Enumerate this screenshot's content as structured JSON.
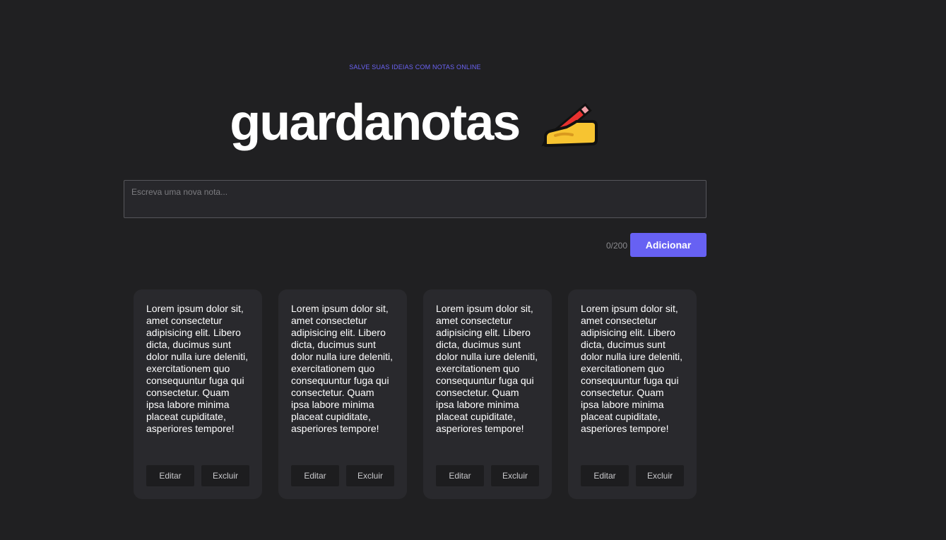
{
  "header": {
    "tagline": "SALVE SUAS IDEIAS COM NOTAS ONLINE",
    "title": "guardanotas",
    "title_icon": "writing-hand-icon"
  },
  "composer": {
    "placeholder": "Escreva uma nova nota...",
    "value": "",
    "counter": "0/200",
    "add_label": "Adicionar"
  },
  "notes": [
    {
      "text": "Lorem ipsum dolor sit, amet consectetur adipisicing elit. Libero dicta, ducimus sunt dolor nulla iure deleniti, exercitationem quo consequuntur fuga qui consectetur. Quam ipsa labore minima placeat cupiditate, asperiores tempore!",
      "edit_label": "Editar",
      "delete_label": "Excluir"
    },
    {
      "text": "Lorem ipsum dolor sit, amet consectetur adipisicing elit. Libero dicta, ducimus sunt dolor nulla iure deleniti, exercitationem quo consequuntur fuga qui consectetur. Quam ipsa labore minima placeat cupiditate, asperiores tempore!",
      "edit_label": "Editar",
      "delete_label": "Excluir"
    },
    {
      "text": "Lorem ipsum dolor sit, amet consectetur adipisicing elit. Libero dicta, ducimus sunt dolor nulla iure deleniti, exercitationem quo consequuntur fuga qui consectetur. Quam ipsa labore minima placeat cupiditate, asperiores tempore!",
      "edit_label": "Editar",
      "delete_label": "Excluir"
    },
    {
      "text": "Lorem ipsum dolor sit, amet consectetur adipisicing elit. Libero dicta, ducimus sunt dolor nulla iure deleniti, exercitationem quo consequuntur fuga qui consectetur. Quam ipsa labore minima placeat cupiditate, asperiores tempore!",
      "edit_label": "Editar",
      "delete_label": "Excluir"
    }
  ],
  "colors": {
    "background": "#202022",
    "accent": "#6761f3",
    "card": "#29292d",
    "tagline": "#6b63f5"
  }
}
